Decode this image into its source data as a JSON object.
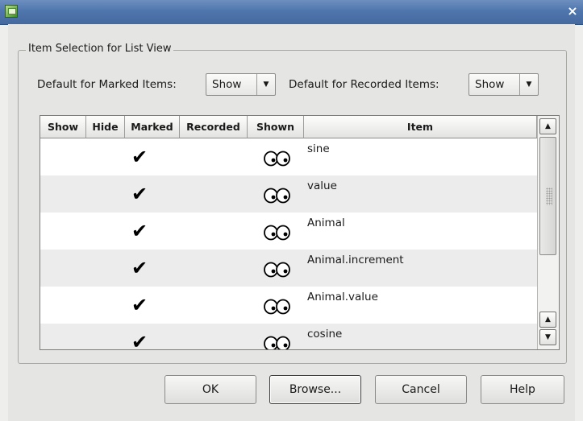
{
  "window": {
    "close_glyph": "×"
  },
  "group": {
    "title": "Item Selection for List View"
  },
  "defaults": {
    "marked_label": "Default for Marked Items:",
    "marked_value": "Show",
    "recorded_label": "Default for Recorded Items:",
    "recorded_value": "Show"
  },
  "table": {
    "columns": [
      "Show",
      "Hide",
      "Marked",
      "Recorded",
      "Shown",
      "Item"
    ],
    "rows": [
      {
        "marked": "✔",
        "shown_icon": "eyes-icon",
        "item": "sine"
      },
      {
        "marked": "✔",
        "shown_icon": "eyes-icon",
        "item": "value"
      },
      {
        "marked": "✔",
        "shown_icon": "eyes-icon",
        "item": "Animal"
      },
      {
        "marked": "✔",
        "shown_icon": "eyes-icon",
        "item": "Animal.increment"
      },
      {
        "marked": "✔",
        "shown_icon": "eyes-icon",
        "item": "Animal.value"
      },
      {
        "marked": "✔",
        "shown_icon": "eyes-icon",
        "item": "cosine"
      }
    ],
    "scroll_up_glyph": "▲",
    "scroll_down_glyph": "▼"
  },
  "buttons": {
    "ok": "OK",
    "browse": "Browse...",
    "cancel": "Cancel",
    "help": "Help"
  },
  "combo_arrow": "▼"
}
